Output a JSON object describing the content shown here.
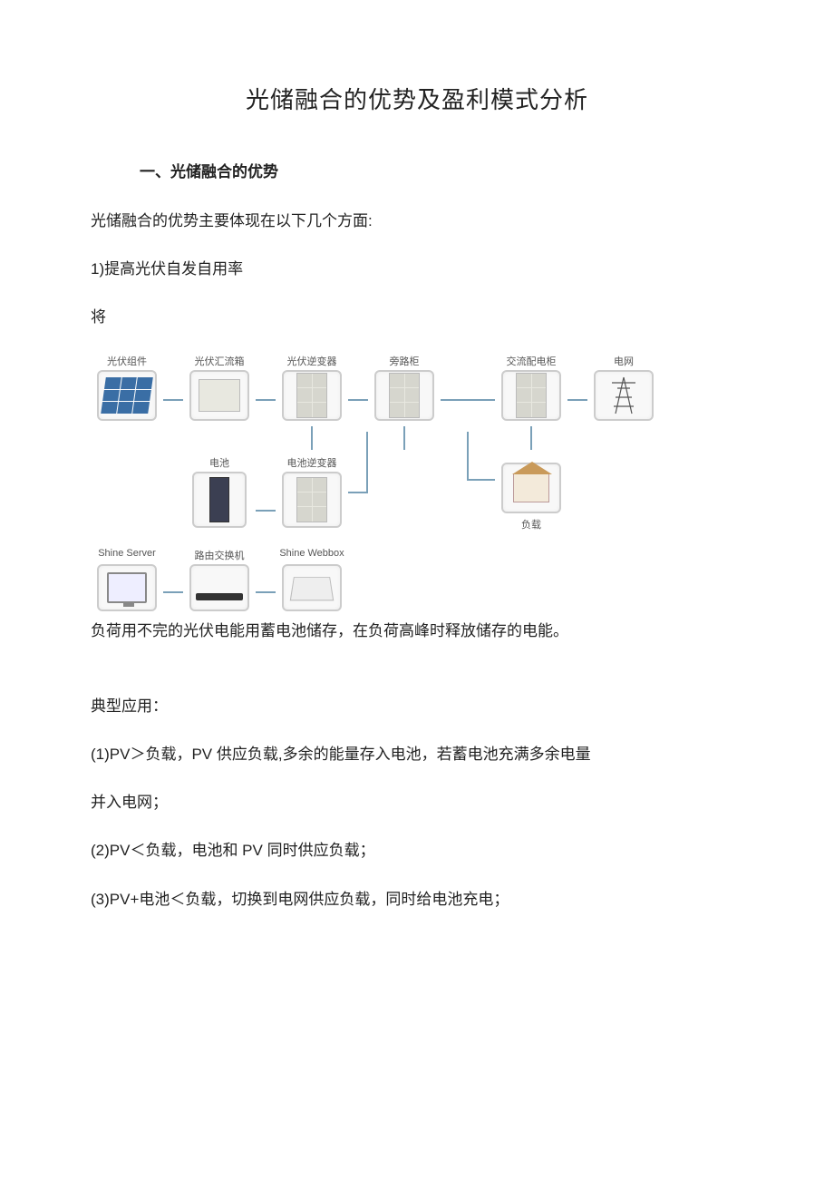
{
  "title": "光储融合的优势及盈利模式分析",
  "section1_heading": "一、光储融合的优势",
  "intro": "光储融合的优势主要体现在以下几个方面:",
  "point1": "1)提高光伏自发自用率",
  "lead_char": "将",
  "diagram_labels": {
    "pv_panel": "光伏组件",
    "combiner": "光伏汇流箱",
    "pv_inverter": "光伏逆变器",
    "meter_cabinet": "旁路柜",
    "ac_cabinet": "交流配电柜",
    "grid": "电网",
    "battery": "电池",
    "batt_inverter": "电池逆变器",
    "load": "负载",
    "server": "Shine Server",
    "router": "路由交换机",
    "webbox": "Shine Webbox"
  },
  "caption_after_diagram": "负荷用不完的光伏电能用蓄电池储存，在负荷高峰时释放储存的电能。",
  "typical_heading": "典型应用：",
  "case1": "(1)PV＞负载，PV 供应负载,多余的能量存入电池，若蓄电池充满多余电量",
  "case1b": "并入电网；",
  "case2": "(2)PV＜负载，电池和 PV 同时供应负载；",
  "case3": "(3)PV+电池＜负载，切换到电网供应负载，同时给电池充电；"
}
